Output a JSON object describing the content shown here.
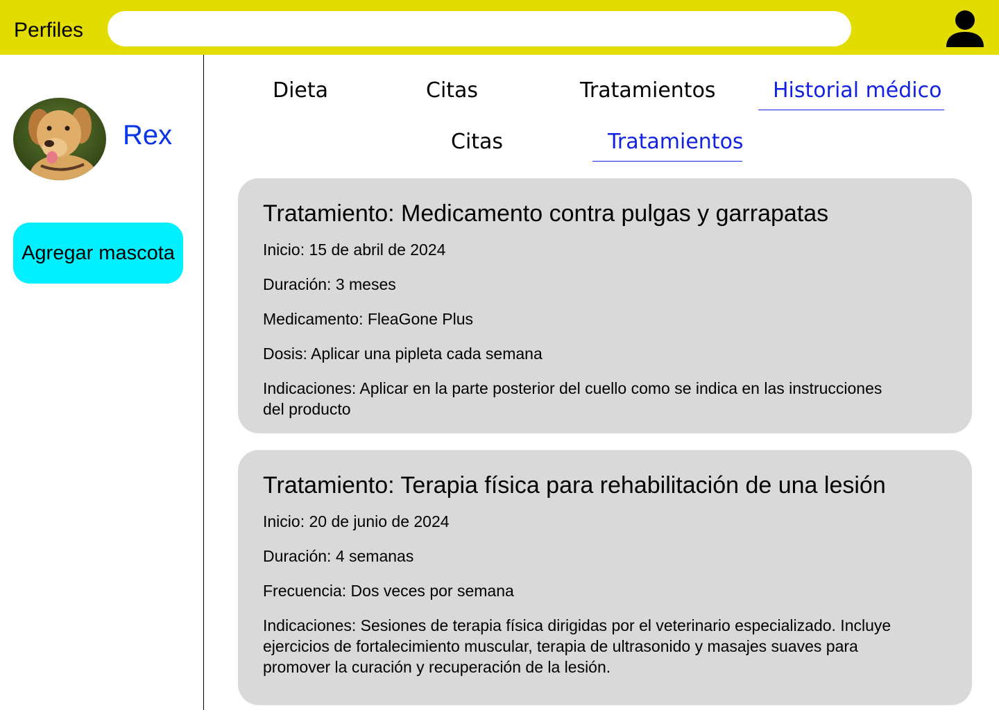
{
  "header": {
    "title": "Perfiles",
    "search_placeholder": "",
    "user_icon": "user-icon"
  },
  "sidebar": {
    "pet_name": "Rex",
    "avatar_icon": "dog-photo",
    "add_pet_label": "Agregar mascota"
  },
  "main_tabs": [
    {
      "label": "Dieta"
    },
    {
      "label": "Citas"
    },
    {
      "label": "Tratamientos"
    },
    {
      "label": "Historial médico",
      "active": true
    }
  ],
  "sub_tabs": [
    {
      "label": "Citas"
    },
    {
      "label": "Tratamientos",
      "active": true
    }
  ],
  "treatments": [
    {
      "title": "Tratamiento: Medicamento contra pulgas y garrapatas",
      "fields": [
        "Inicio: 15 de abril de 2024",
        "Duración: 3 meses",
        "Medicamento: FleaGone Plus",
        "Dosis: Aplicar una pipleta cada semana",
        "Indicaciones: Aplicar en la parte posterior del cuello como se indica en las instrucciones del producto"
      ]
    },
    {
      "title": "Tratamiento: Terapia física para rehabilitación de una lesión",
      "fields": [
        "Inicio: 20 de junio de 2024",
        "Duración: 4 semanas",
        "Frecuencia: Dos veces por semana",
        "Indicaciones: Sesiones de terapia física dirigidas por el veterinario especializado. Incluye ejercicios de fortalecimiento muscular, terapia de ultrasonido y masajes suaves para promover la curación y recuperación de la lesión."
      ]
    }
  ],
  "colors": {
    "header_bg": "#e3dc00",
    "accent_blue": "#1322e0",
    "pet_name": "#0a35e6",
    "add_button": "#00f0ff",
    "card_bg": "#d9d9d9"
  }
}
